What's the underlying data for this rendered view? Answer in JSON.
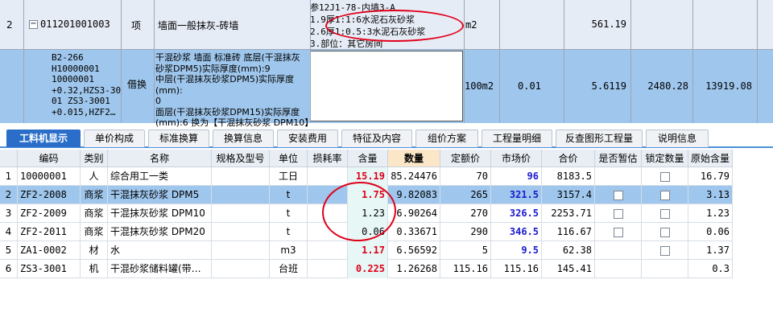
{
  "top": {
    "row1": {
      "num": "2",
      "code": "011201001003",
      "type": "项",
      "name": "墙面一般抹灰-砖墙",
      "features": [
        "参12J1-78-内墙3-A",
        "1.9厚1:1:6水泥石灰砂浆",
        "2.6厚1:0.5:3水泥石灰砂浆",
        "3.部位：其它房间"
      ],
      "unit": "m2",
      "qty": "561.19"
    },
    "row2": {
      "codes": [
        "B2-266",
        "H10000001",
        "10000001",
        "+0.32,HZS3-30",
        "01 ZS3-3001",
        "+0.015,HZF2…"
      ],
      "type": "借换",
      "desc": [
        "干混砂浆 墙面 标准砖 底层(干混抹灰",
        "砂浆DPM5)实际厚度(mm):9",
        "中层(干混抹灰砂浆DPM5)实际厚度(mm):",
        "0",
        "面层(干混抹灰砂浆DPM15)实际厚度",
        "(mm):6  换为【干混抹灰砂浆 DPM10】"
      ],
      "unit": "100m2",
      "rate": "0.01",
      "qty": "5.6119",
      "price": "2480.28",
      "total": "13919.08"
    }
  },
  "tabs": [
    "工料机显示",
    "单价构成",
    "标准换算",
    "换算信息",
    "安装费用",
    "特征及内容",
    "组价方案",
    "工程量明细",
    "反查图形工程量",
    "说明信息"
  ],
  "grid": {
    "headers": [
      "编码",
      "类别",
      "名称",
      "规格及型号",
      "单位",
      "损耗率",
      "含量",
      "数量",
      "定额价",
      "市场价",
      "合价",
      "是否暂估",
      "锁定数量",
      "原始含量"
    ],
    "rows": [
      {
        "n": "1",
        "code": "10000001",
        "cat": "人",
        "name": "综合用工一类",
        "unit": "工日",
        "content": "15.19",
        "qty": "85.24476",
        "quota": "70",
        "market": "96",
        "sum": "8183.5",
        "est": false,
        "lock": true,
        "orig": "16.79"
      },
      {
        "n": "2",
        "code": "ZF2-2008",
        "cat": "商浆",
        "name": "干混抹灰砂浆 DPM5",
        "unit": "t",
        "content": "1.75",
        "qty": "9.82083",
        "quota": "265",
        "market": "321.5",
        "sum": "3157.4",
        "est": true,
        "lock": true,
        "orig": "3.13"
      },
      {
        "n": "3",
        "code": "ZF2-2009",
        "cat": "商浆",
        "name": "干混抹灰砂浆 DPM10",
        "unit": "t",
        "content": "1.23",
        "qty": "6.90264",
        "quota": "270",
        "market": "326.5",
        "sum": "2253.71",
        "est": true,
        "lock": true,
        "orig": "1.23"
      },
      {
        "n": "4",
        "code": "ZF2-2011",
        "cat": "商浆",
        "name": "干混抹灰砂浆 DPM20",
        "unit": "t",
        "content": "0.06",
        "qty": "0.33671",
        "quota": "290",
        "market": "346.5",
        "sum": "116.67",
        "est": true,
        "lock": true,
        "orig": "0.06"
      },
      {
        "n": "5",
        "code": "ZA1-0002",
        "cat": "材",
        "name": "水",
        "unit": "m3",
        "content": "1.17",
        "qty": "6.56592",
        "quota": "5",
        "market": "9.5",
        "sum": "62.38",
        "est": false,
        "lock": true,
        "orig": "1.37"
      },
      {
        "n": "6",
        "code": "ZS3-3001",
        "cat": "机",
        "name": "干混砂浆储料罐(带…",
        "unit": "台班",
        "content": "0.225",
        "qty": "1.26268",
        "quota": "115.16",
        "market": "115.16",
        "sum": "145.41",
        "est": false,
        "lock": false,
        "orig": "0.3"
      }
    ]
  },
  "colors": {
    "selected": "#9fc6ec",
    "red": "#e0001a",
    "blue": "#1a1ad0",
    "tab_active": "#2a6ec9"
  }
}
